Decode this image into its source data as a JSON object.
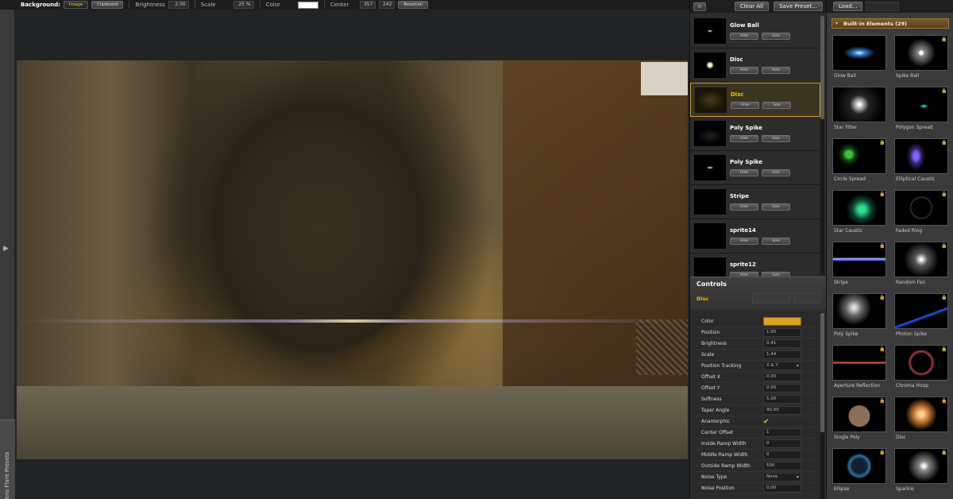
{
  "topbar": {
    "background_label": "Background:",
    "image_btn": "Image",
    "clipboard_btn": "Clipboard",
    "brightness_label": "Brightness",
    "brightness_value": "2.00",
    "scale_label": "Scale",
    "scale_value": "25 %",
    "color_label": "Color",
    "color_value": "#ffffff",
    "center_label": "Center",
    "center_x": "357",
    "center_y": "242",
    "reset_btn": "Reset/all"
  },
  "left": {
    "expand_arrow": "▶",
    "presets_tab": "Lens Flare Presets"
  },
  "layers": {
    "menu_glyph": "≡",
    "clear_all": "Clear All",
    "save_preset": "Save Preset...",
    "hide_label": "Hide",
    "solo_label": "Solo",
    "items": [
      {
        "name": "Glow Ball",
        "thumb": "glowball"
      },
      {
        "name": "Disc",
        "thumb": "disc1"
      },
      {
        "name": "Disc",
        "thumb": "disc2",
        "selected": true
      },
      {
        "name": "Poly Spike",
        "thumb": "poly1"
      },
      {
        "name": "Poly Spike",
        "thumb": "poly2"
      },
      {
        "name": "Stripe",
        "thumb": "none"
      },
      {
        "name": "sprite14",
        "thumb": "none"
      },
      {
        "name": "sprite12",
        "thumb": "none"
      }
    ]
  },
  "controls": {
    "title": "Controls",
    "element_name": "Disc",
    "accent_color": "#e0a020",
    "params": [
      {
        "name": "Color",
        "value": "",
        "type": "color"
      },
      {
        "name": "Position",
        "value": "1.00"
      },
      {
        "name": "Brightness",
        "value": "0.41"
      },
      {
        "name": "Scale",
        "value": "1.44"
      },
      {
        "name": "Position Tracking",
        "value": "X & Y",
        "type": "drop"
      },
      {
        "name": "Offset X",
        "value": "0.00"
      },
      {
        "name": "Offset Y",
        "value": "0.00"
      },
      {
        "name": "Softness",
        "value": "5.00"
      },
      {
        "name": "Taper Angle",
        "value": "90.00"
      },
      {
        "name": "Anamorphic",
        "value": "✔",
        "type": "check"
      },
      {
        "name": "Center Offset",
        "value": "1"
      },
      {
        "name": "Inside Ramp Width",
        "value": "0"
      },
      {
        "name": "Middle Ramp Width",
        "value": "0"
      },
      {
        "name": "Outside Ramp Width",
        "value": "500"
      },
      {
        "name": "Noise Type",
        "value": "None",
        "type": "drop"
      },
      {
        "name": "Noise Position",
        "value": "0.00"
      }
    ]
  },
  "builtin": {
    "load_btn": "Load...",
    "header": "Built-in Elements (29)",
    "expand_glyph": "▾",
    "lock_glyph": "🔒",
    "elements": [
      {
        "name": "Glow Ball",
        "art": "glowball",
        "locked": false
      },
      {
        "name": "Spike Ball",
        "art": "spikeball",
        "locked": true
      },
      {
        "name": "Star Filter",
        "art": "starfilter",
        "locked": false
      },
      {
        "name": "Polygon Spread",
        "art": "polyspread",
        "locked": true
      },
      {
        "name": "Circle Spread",
        "art": "circlespread",
        "locked": true
      },
      {
        "name": "Elliptical Caustic",
        "art": "elliptical",
        "locked": true
      },
      {
        "name": "Star Caustic",
        "art": "starcaustic",
        "locked": true
      },
      {
        "name": "Faded Ring",
        "art": "fadedring",
        "locked": true
      },
      {
        "name": "Stripe",
        "art": "stripe",
        "locked": true
      },
      {
        "name": "Random Fan",
        "art": "randomfan",
        "locked": true
      },
      {
        "name": "Poly Spike",
        "art": "polyspike",
        "locked": true
      },
      {
        "name": "Photon Spike",
        "art": "photon",
        "locked": true
      },
      {
        "name": "Aperture Reflection",
        "art": "aperture",
        "locked": true
      },
      {
        "name": "Chroma Hoop",
        "art": "chroma",
        "locked": true
      },
      {
        "name": "Single Poly",
        "art": "singlepoly",
        "locked": true
      },
      {
        "name": "Disc",
        "art": "disc",
        "locked": true
      },
      {
        "name": "Ellipse",
        "art": "ellipse",
        "locked": true
      },
      {
        "name": "Sparkle",
        "art": "sparkle",
        "locked": true
      }
    ]
  }
}
